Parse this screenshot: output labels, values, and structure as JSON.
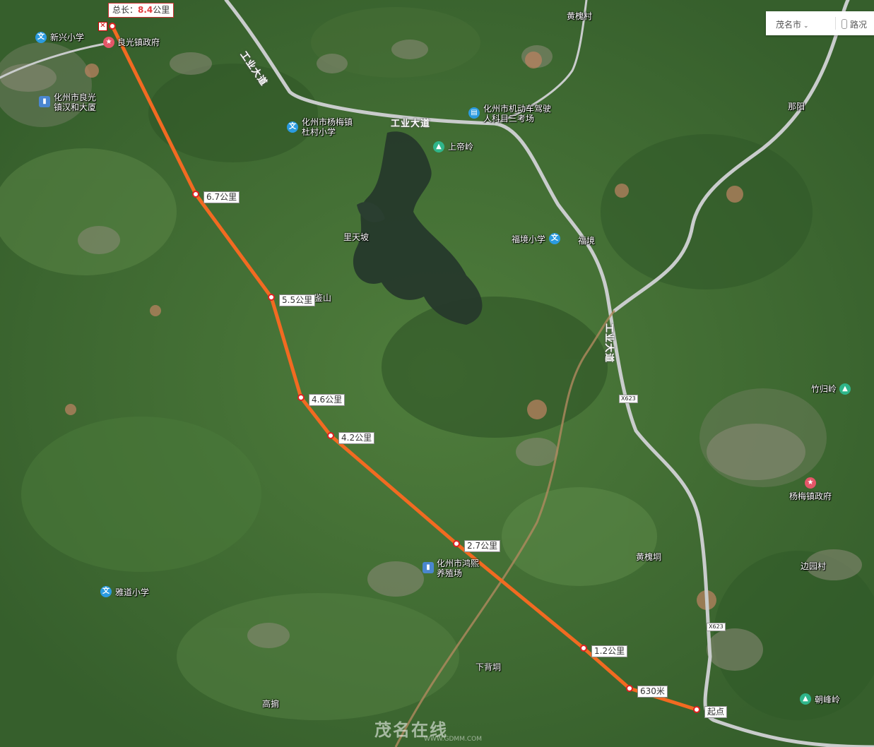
{
  "toolbar": {
    "city": "茂名市",
    "traffic": "路况"
  },
  "route": {
    "total_prefix": "总长：",
    "total_value": "8.4",
    "total_unit": "公里",
    "markers": [
      {
        "id": "m-6-7",
        "label": "6.7公里"
      },
      {
        "id": "m-5-5",
        "label": "5.5公里"
      },
      {
        "id": "m-4-6",
        "label": "4.6公里"
      },
      {
        "id": "m-4-2",
        "label": "4.2公里"
      },
      {
        "id": "m-2-7",
        "label": "2.7公里"
      },
      {
        "id": "m-1-2",
        "label": "1.2公里"
      },
      {
        "id": "m-630",
        "label": "630米"
      },
      {
        "id": "m-start",
        "label": "起点"
      }
    ],
    "line_color": "#f26a21"
  },
  "places": {
    "xinxing_school": "新兴小学",
    "liangguang_gov": "良光镇政府",
    "liangguang_building": "化州市良光镇汉和大厦",
    "dushu_school": "化州市杨梅镇杜村小学",
    "driving_exam": "化州市机动车驾驶人科目三考场",
    "shangdiling": "上帝岭",
    "huanghuaicun": "黄槐村",
    "nayang": "那阳",
    "litianpo": "里天坡",
    "jianshan": "鉴山",
    "fujing_school": "福境小学",
    "fujing": "福境",
    "zhuguiling": "竹归岭",
    "yangmei_gov": "杨梅镇政府",
    "huanghuaidong": "黄槐垌",
    "bianyuancun": "边园村",
    "hongxi_farm": "化州市鸿熙养殖场",
    "yadao_school": "雅道小学",
    "xiabeidong": "下背垌",
    "gaoqing": "高掮",
    "chaofengling": "朝峰岭"
  },
  "roads": {
    "gongye_1": "工业大道",
    "gongye_2": "工业大道",
    "gongye_3": "工业大道",
    "x623_a": "X623",
    "x623_b": "X623"
  },
  "watermark": {
    "main": "茂名在线",
    "sub": "WWW.GDMM.COM"
  }
}
